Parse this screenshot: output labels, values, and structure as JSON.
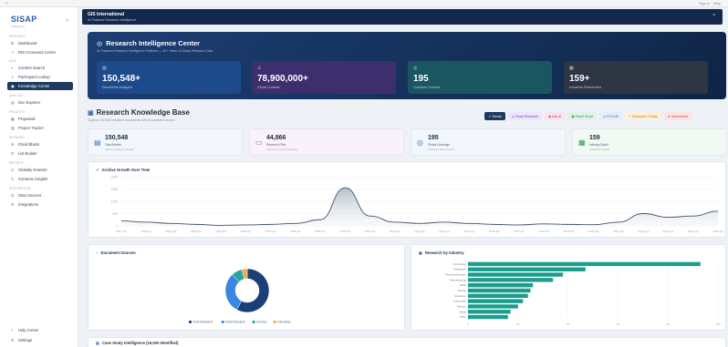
{
  "topstrip": {
    "left": "≡",
    "right": "Sign in · Help"
  },
  "sidebar": {
    "logo": "SISAP",
    "logo_sub": "Intelligence",
    "collapse_icon": "«",
    "sections": [
      "Research",
      "Data",
      "Analysis",
      "Projects",
      "Network",
      "Reports",
      "Integrations"
    ],
    "items": [
      {
        "label": "Dashboard",
        "icon": "⊞"
      },
      {
        "label": "RIS Command Center",
        "icon": "↗"
      },
      {
        "label": "Content Search",
        "icon": "⌕"
      },
      {
        "label": "Participant Lookup",
        "icon": "♙"
      },
      {
        "label": "Knowledge Center",
        "icon": "▣"
      },
      {
        "label": "Doc Explorer",
        "icon": "▤"
      },
      {
        "label": "Proposals",
        "icon": "▦"
      },
      {
        "label": "Project Tracker",
        "icon": "▥"
      },
      {
        "label": "Email Blasts",
        "icon": "✉"
      },
      {
        "label": "List Builder",
        "icon": "☰"
      },
      {
        "label": "Globally Network",
        "icon": "◎"
      },
      {
        "label": "Contents Insights",
        "icon": "✎"
      },
      {
        "label": "Data Sources",
        "icon": "⇅"
      },
      {
        "label": "Integrations",
        "icon": "⚙"
      },
      {
        "label": "Help Center",
        "icon": "?"
      },
      {
        "label": "Settings",
        "icon": "⚙"
      }
    ]
  },
  "header": {
    "title": "GIS International",
    "subtitle": "AI-Powered Research Intelligence",
    "close": "×"
  },
  "hero": {
    "title": "Research Intelligence Center",
    "subtitle": "AI-Powered Research Intelligence Platform — 40+ Years of Global Research Data",
    "stats": [
      {
        "value": "150,548+",
        "label": "Documents Analyzed",
        "icon": "▤",
        "color": "#1d4a8a"
      },
      {
        "value": "78,900,000+",
        "label": "Global Contacts",
        "icon": "♙",
        "color": "#3d2f6e"
      },
      {
        "value": "195",
        "label": "Countries Covered",
        "icon": "◎",
        "color": "#1a5660"
      },
      {
        "value": "159+",
        "label": "Industries Researched",
        "icon": "▦",
        "color": "#2e3644"
      }
    ]
  },
  "kb": {
    "title": "Research Knowledge Base",
    "subtitle": "Explore 150,548 research documents with AI-powered search",
    "tabs": [
      {
        "label": "↗ Trends",
        "bg": "#1e3a5f",
        "fg": "#ffffff"
      },
      {
        "label": "◎ Deep Research",
        "bg": "#ece6fb",
        "fg": "#5b3fb5"
      },
      {
        "label": "◉ Ask AI",
        "bg": "#fbe3ef",
        "fg": "#b33a76"
      },
      {
        "label": "▦ Panel Score",
        "bg": "#e1f3e6",
        "fg": "#2b8a4b"
      },
      {
        "label": "◎ FOCUS",
        "bg": "#e3eefb",
        "fg": "#2f62ad"
      },
      {
        "label": "✧ Economic Trends",
        "bg": "#fdf0dd",
        "fg": "#b9741e"
      },
      {
        "label": "★ Summaries",
        "bg": "#fde4e4",
        "fg": "#c04444"
      }
    ],
    "mini": [
      {
        "value": "150,548",
        "label": "Total Articles",
        "desc": "With AI-powered research",
        "icon": "▤",
        "bg": "#f2f6fd",
        "ic": "#3b6fc2"
      },
      {
        "value": "44,866",
        "label": "Research Files",
        "desc": "Indexed research repository",
        "icon": "▭",
        "bg": "#faf2fa",
        "ic": "#b34fa3"
      },
      {
        "value": "195",
        "label": "Global Coverage",
        "desc": "Countries with research",
        "icon": "◎",
        "bg": "#f2f6fd",
        "ic": "#3b6fc2"
      },
      {
        "value": "159",
        "label": "Industry Depth",
        "desc": "Industries tracked",
        "icon": "▦",
        "bg": "#f1f9f3",
        "ic": "#2a9a55"
      }
    ]
  },
  "panels": {
    "growth_title": "Archive Growth Over Time",
    "sources_title": "Document Sources",
    "industry_title": "Research by Industry",
    "case_study_title": "Case Study Intelligence (18,000 Identified)"
  },
  "chart_data": [
    {
      "type": "area",
      "title": "Archive Growth Over Time",
      "x": [
        "2001-Q1",
        "2002-Q1",
        "2003-Q1",
        "2004-Q1",
        "2005-Q1",
        "2006-Q1",
        "2007-Q1",
        "2008-Q1",
        "2009-Q1",
        "2010-Q1",
        "2011-Q1",
        "2012-Q1",
        "2013-Q1",
        "2014-Q1",
        "2015-Q1",
        "2016-Q1",
        "2017-Q1",
        "2018-Q1",
        "2019-Q1",
        "2020-Q1",
        "2021-Q1",
        "2022-Q1",
        "2023-Q1",
        "2024-Q1",
        "2025-Q1"
      ],
      "y": [
        200,
        150,
        100,
        60,
        20,
        40,
        60,
        100,
        250,
        1550,
        400,
        150,
        100,
        150,
        100,
        60,
        40,
        80,
        60,
        50,
        150,
        500,
        350,
        400,
        600
      ],
      "ylim": [
        0,
        2000
      ],
      "y_ticks": [
        "2000",
        "1500",
        "1000",
        "500",
        "0"
      ],
      "grid": true
    },
    {
      "type": "pie",
      "title": "Document Sources",
      "labels": [
        "Field Research",
        "Desk Research",
        "Surveys",
        "Interviews"
      ],
      "values": [
        58,
        30,
        8,
        4
      ],
      "colors": [
        "#1d3f78",
        "#3a86e0",
        "#22a6a6",
        "#f2a93b"
      ],
      "legend": "bottom"
    },
    {
      "type": "bar",
      "title": "Research by Industry",
      "categories": [
        "Technology",
        "Healthcare",
        "Financial Services",
        "Manufacturing",
        "Retail",
        "Energy",
        "Education",
        "Automotive",
        "Telecom",
        "Media",
        "Other"
      ],
      "values": [
        93,
        47,
        38,
        34,
        26,
        25,
        24,
        22,
        20,
        17,
        16
      ],
      "xlim": [
        0,
        100
      ],
      "color": "#1a9d8c"
    }
  ]
}
